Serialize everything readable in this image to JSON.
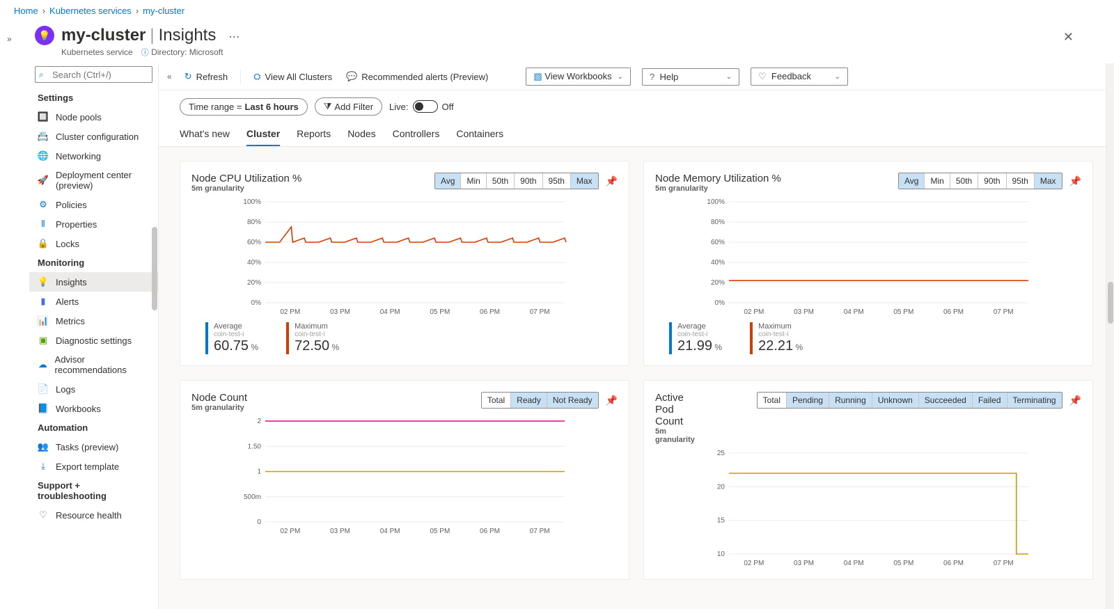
{
  "breadcrumb": [
    "Home",
    "Kubernetes services",
    "my-cluster"
  ],
  "header": {
    "resource_name": "my-cluster",
    "blade_name": "Insights",
    "resource_type": "Kubernetes service",
    "directory_label": "Directory: Microsoft"
  },
  "search_placeholder": "Search (Ctrl+/)",
  "sidebar": {
    "groups": [
      {
        "heading": "Settings",
        "items": [
          {
            "icon": "🔲",
            "color": "#8661c5",
            "label": "Node pools"
          },
          {
            "icon": "📇",
            "color": "#0078d4",
            "label": "Cluster configuration"
          },
          {
            "icon": "🌐",
            "color": "#0078d4",
            "label": "Networking"
          },
          {
            "icon": "🚀",
            "color": "#0078d4",
            "label": "Deployment center (preview)"
          },
          {
            "icon": "⚙",
            "color": "#0078d4",
            "label": "Policies"
          },
          {
            "icon": "⦀",
            "color": "#0078d4",
            "label": "Properties"
          },
          {
            "icon": "🔒",
            "color": "#605e5c",
            "label": "Locks"
          }
        ]
      },
      {
        "heading": "Monitoring",
        "items": [
          {
            "icon": "💡",
            "color": "#8661c5",
            "label": "Insights",
            "active": true
          },
          {
            "icon": "▮",
            "color": "#4f6bed",
            "label": "Alerts"
          },
          {
            "icon": "📊",
            "color": "#0078d4",
            "label": "Metrics"
          },
          {
            "icon": "▣",
            "color": "#57a300",
            "label": "Diagnostic settings"
          },
          {
            "icon": "☁",
            "color": "#0078d4",
            "label": "Advisor recommendations"
          },
          {
            "icon": "📄",
            "color": "#ef6950",
            "label": "Logs"
          },
          {
            "icon": "📘",
            "color": "#0078d4",
            "label": "Workbooks"
          }
        ]
      },
      {
        "heading": "Automation",
        "items": [
          {
            "icon": "👥",
            "color": "#0078d4",
            "label": "Tasks (preview)"
          },
          {
            "icon": "⤓",
            "color": "#0078d4",
            "label": "Export template"
          }
        ]
      },
      {
        "heading": "Support + troubleshooting",
        "items": [
          {
            "icon": "♡",
            "color": "#605e5c",
            "label": "Resource health"
          }
        ]
      }
    ]
  },
  "toolbar": {
    "refresh": "Refresh",
    "view_all": "View All Clusters",
    "alerts": "Recommended alerts (Preview)",
    "workbooks": "View Workbooks",
    "help": "Help",
    "feedback": "Feedback"
  },
  "filters": {
    "time_label": "Time range = ",
    "time_value": "Last 6 hours",
    "add_filter": "Add Filter",
    "live_label": "Live:",
    "live_value": "Off"
  },
  "tabs": [
    "What's new",
    "Cluster",
    "Reports",
    "Nodes",
    "Controllers",
    "Containers"
  ],
  "active_tab": "Cluster",
  "x_ticks": [
    "02 PM",
    "03 PM",
    "04 PM",
    "05 PM",
    "06 PM",
    "07 PM"
  ],
  "cards": {
    "cpu": {
      "title": "Node CPU Utilization %",
      "sub": "5m granularity",
      "agg": [
        "Avg",
        "Min",
        "50th",
        "90th",
        "95th",
        "Max"
      ],
      "agg_active": [
        "Avg",
        "Max"
      ],
      "legend": [
        {
          "label": "Average",
          "sub": "coin-test-i",
          "value": "60.75",
          "unit": "%",
          "color": "#0078d4"
        },
        {
          "label": "Maximum",
          "sub": "coin-test-i",
          "value": "72.50",
          "unit": "%",
          "color": "#d83b01"
        }
      ],
      "chart_data": {
        "type": "line",
        "y_ticks": [
          "0%",
          "20%",
          "40%",
          "60%",
          "80%",
          "100%"
        ],
        "ylim": [
          0,
          100
        ],
        "series": [
          {
            "name": "avg",
            "color": "#d83b01",
            "baseline": 60,
            "spikes": true
          }
        ]
      }
    },
    "mem": {
      "title": "Node Memory Utilization %",
      "sub": "5m granularity",
      "agg": [
        "Avg",
        "Min",
        "50th",
        "90th",
        "95th",
        "Max"
      ],
      "agg_active": [
        "Avg",
        "Max"
      ],
      "legend": [
        {
          "label": "Average",
          "sub": "coin-test-i",
          "value": "21.99",
          "unit": "%",
          "color": "#0078d4"
        },
        {
          "label": "Maximum",
          "sub": "coin-test-i",
          "value": "22.21",
          "unit": "%",
          "color": "#d83b01"
        }
      ],
      "chart_data": {
        "type": "line",
        "y_ticks": [
          "0%",
          "20%",
          "40%",
          "60%",
          "80%",
          "100%"
        ],
        "ylim": [
          0,
          100
        ],
        "series": [
          {
            "name": "avg",
            "color": "#d83b01",
            "baseline": 22,
            "spikes": false
          }
        ]
      }
    },
    "nodes": {
      "title": "Node Count",
      "sub": "5m granularity",
      "agg": [
        "Total",
        "Ready",
        "Not Ready"
      ],
      "agg_active": [
        "Ready",
        "Not Ready"
      ],
      "chart_data": {
        "type": "line",
        "y_ticks": [
          "0",
          "500m",
          "1",
          "1.50",
          "2"
        ],
        "ylim": [
          0,
          2
        ],
        "series": [
          {
            "name": "ready",
            "color": "#e3008c",
            "baseline": 2
          },
          {
            "name": "total",
            "color": "#ca9b00",
            "baseline": 1
          }
        ]
      }
    },
    "pods": {
      "title": "Active Pod Count",
      "sub": "5m granularity",
      "agg": [
        "Total",
        "Pending",
        "Running",
        "Unknown",
        "Succeeded",
        "Failed",
        "Terminating"
      ],
      "agg_active": [
        "Pending",
        "Running",
        "Unknown",
        "Succeeded",
        "Failed",
        "Terminating"
      ],
      "chart_data": {
        "type": "line",
        "y_ticks": [
          "10",
          "15",
          "20",
          "25"
        ],
        "ylim": [
          10,
          25
        ],
        "series": [
          {
            "name": "running",
            "color": "#ca9b00",
            "baseline": 22,
            "drop_at_end": 10
          }
        ]
      }
    }
  }
}
